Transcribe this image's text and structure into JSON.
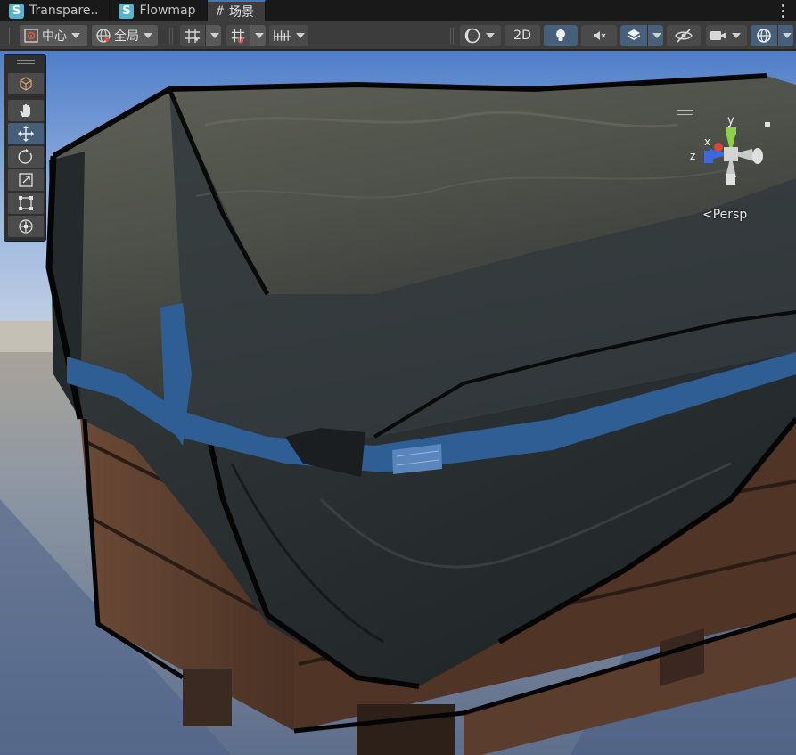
{
  "tabs": [
    {
      "label": "Transpare..",
      "icon": "shader-graph-icon"
    },
    {
      "label": "Flowmap",
      "icon": "shader-graph-icon"
    },
    {
      "label": "场景",
      "icon": "scene-hash-icon"
    }
  ],
  "tab_icon_letter": "S",
  "tab_hash_glyph": "#",
  "toolbar": {
    "pivot_label": "中心",
    "space_label": "全局",
    "mode_2d_label": "2D"
  },
  "scene_view": {
    "axis_y": "y",
    "axis_x": "x",
    "axis_z": "z",
    "projection_label": "Persp"
  },
  "colors": {
    "accent_active": "#46607c",
    "tab_active_border": "#3a79bb",
    "shader_badge": "#5bb3c9",
    "axis_y": "#8dd14a",
    "axis_x": "#d9463b",
    "axis_z": "#3b6bd9"
  }
}
